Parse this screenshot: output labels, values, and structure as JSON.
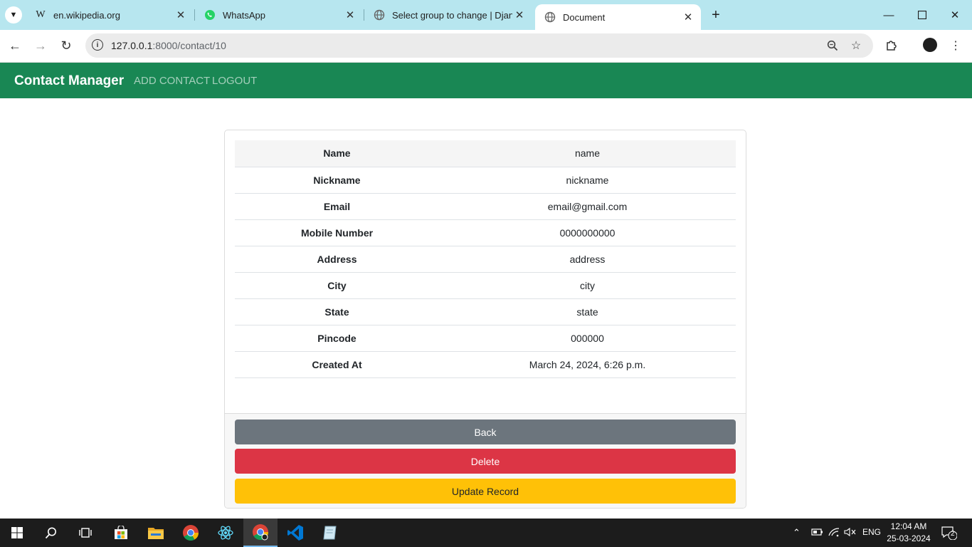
{
  "browser": {
    "tabs": [
      {
        "title": "en.wikipedia.org",
        "favicon": "wikipedia-icon"
      },
      {
        "title": "WhatsApp",
        "favicon": "whatsapp-icon"
      },
      {
        "title": "Select group to change | Djang",
        "favicon": "globe-icon"
      },
      {
        "title": "Document",
        "favicon": "globe-icon",
        "active": true
      }
    ],
    "url_host": "127.0.0.1",
    "url_path": ":8000/contact/10"
  },
  "navbar": {
    "brand": "Contact Manager",
    "links": [
      "ADD CONTACT",
      "LOGOUT"
    ],
    "color": "#198754"
  },
  "contact": {
    "rows": [
      {
        "label": "Name",
        "value": "name"
      },
      {
        "label": "Nickname",
        "value": "nickname"
      },
      {
        "label": "Email",
        "value": "email@gmail.com"
      },
      {
        "label": "Mobile Number",
        "value": "0000000000"
      },
      {
        "label": "Address",
        "value": "address"
      },
      {
        "label": "City",
        "value": "city"
      },
      {
        "label": "State",
        "value": "state"
      },
      {
        "label": "Pincode",
        "value": "000000"
      },
      {
        "label": "Created At",
        "value": "March 24, 2024, 6:26 p.m."
      }
    ]
  },
  "actions": {
    "back": "Back",
    "delete": "Delete",
    "update": "Update Record",
    "colors": {
      "back": "#6c757d",
      "delete": "#dc3545",
      "update": "#ffc107"
    }
  },
  "taskbar": {
    "language": "ENG",
    "time": "12:04 AM",
    "date": "25-03-2024",
    "notifications": "2"
  }
}
